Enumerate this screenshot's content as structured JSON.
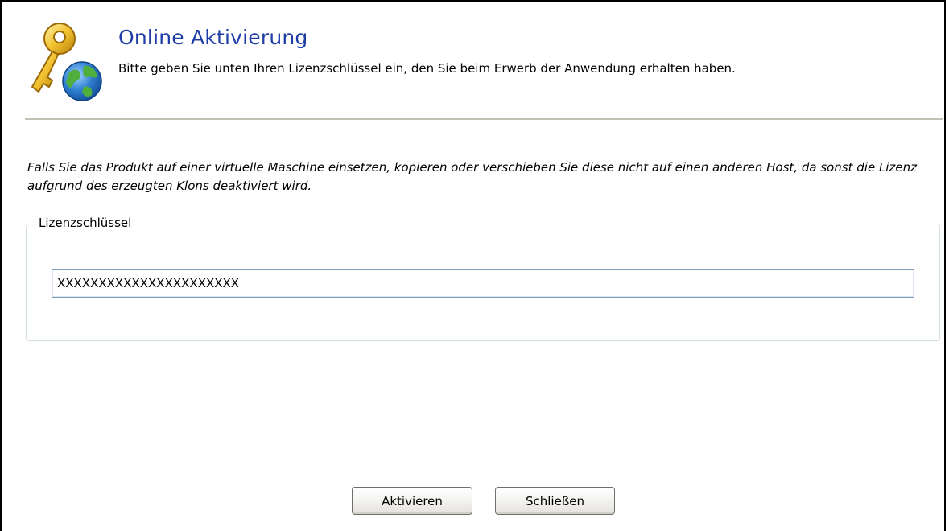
{
  "header": {
    "icon": "key-globe-icon",
    "title": "Online Aktivierung",
    "subtitle": "Bitte geben Sie unten Ihren Lizenzschlüssel ein, den Sie beim Erwerb der Anwendung erhalten haben."
  },
  "info_text": "Falls Sie das Produkt auf einer virtuelle Maschine einsetzen, kopieren oder verschieben Sie diese nicht auf einen anderen Host, da sonst die Lizenz aufgrund des erzeugten Klons deaktiviert wird.",
  "license_group": {
    "legend": "Lizenzschlüssel",
    "input_value": "XXXXXXXXXXXXXXXXXXXXXX"
  },
  "buttons": {
    "activate_label": "Aktivieren",
    "close_label": "Schließen"
  },
  "colors": {
    "title": "#1e3da6",
    "divider": "#c2c0b5",
    "group_border": "#d3dfe7",
    "input_border": "#7f9db9"
  }
}
